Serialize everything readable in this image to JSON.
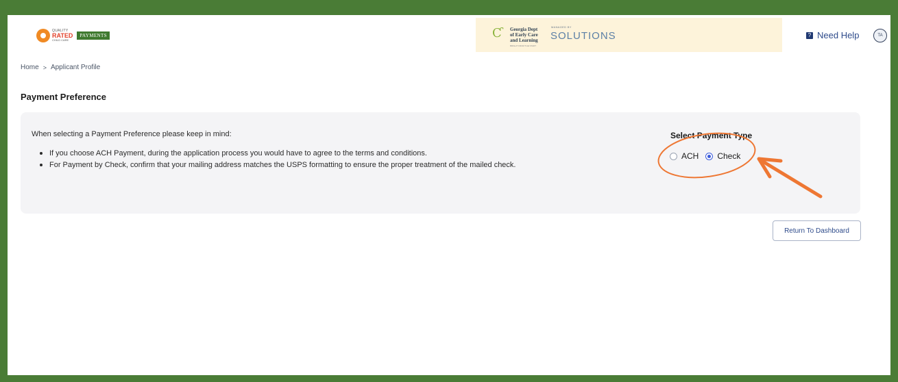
{
  "header": {
    "logo_small": "QUALITY",
    "logo_main": "RATED",
    "logo_sub": "CHILD CARE",
    "badge": "PAYMENTS",
    "partner": {
      "decal_lines": [
        "Georgia Dept",
        "of Early Care",
        "and Learning"
      ],
      "decal_tagline": "BRIGHT FROM THE START",
      "managed_by": "MANAGED BY",
      "solutions": "SOLUTIONS"
    },
    "help_label": "Need Help",
    "avatar_initials": "TA"
  },
  "breadcrumb": {
    "home": "Home",
    "separator": ">",
    "current": "Applicant Profile"
  },
  "page_title": "Payment Preference",
  "panel": {
    "intro": "When selecting a Payment Preference please keep in mind:",
    "bullets": [
      "If you choose ACH Payment, during the application process you would have to agree to the terms and conditions.",
      "For Payment by Check, confirm that your mailing address matches the USPS formatting to ensure the proper treatment of the mailed check."
    ],
    "payment_type_title": "Select Payment Type",
    "options": [
      {
        "label": "ACH",
        "selected": false
      },
      {
        "label": "Check",
        "selected": true
      }
    ]
  },
  "return_button": "Return To Dashboard",
  "colors": {
    "frame_border": "#4a7c36",
    "accent": "#3b5bdb",
    "annotation": "#ee7733"
  }
}
